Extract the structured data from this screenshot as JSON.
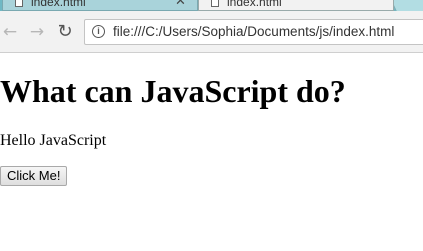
{
  "browser": {
    "tabs": [
      {
        "title": "index.html",
        "active": false
      },
      {
        "title": "index.html",
        "active": true
      }
    ],
    "tab_close_glyph": "✕",
    "nav": {
      "back_icon": "←",
      "forward_icon": "→",
      "reload_icon": "↻"
    },
    "address_bar": {
      "info_icon": "i",
      "url": "file:///C:/Users/Sophia/Documents/js/index.html"
    }
  },
  "page": {
    "heading": "What can JavaScript do?",
    "paragraph": "Hello JavaScript",
    "button_label": "Click Me!"
  }
}
